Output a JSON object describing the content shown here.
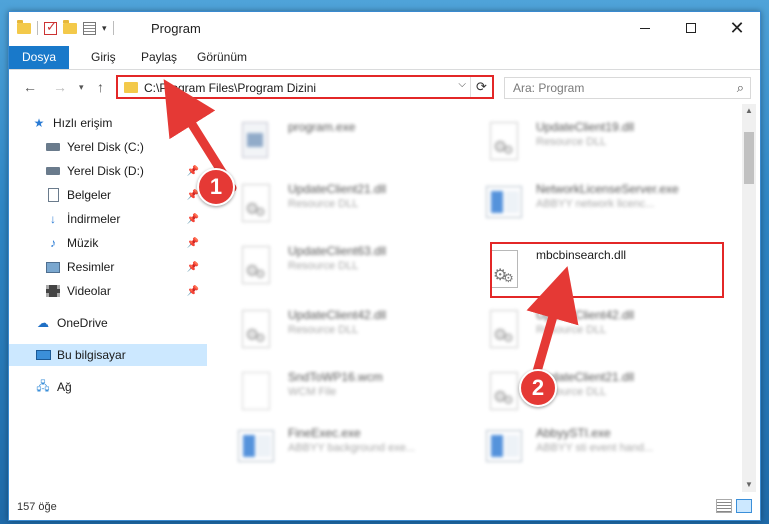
{
  "window": {
    "title": "Program",
    "controls": {
      "minimize": "minimize",
      "maximize": "maximize",
      "close": "✕"
    }
  },
  "ribbon": {
    "tabs": [
      {
        "label": "Dosya",
        "active": true
      },
      {
        "label": "Giriş"
      },
      {
        "label": "Paylaş"
      },
      {
        "label": "Görünüm"
      }
    ]
  },
  "address": {
    "path": "C:\\Program Files\\Program Dizini",
    "refresh_icon": "⟳"
  },
  "search": {
    "placeholder": "Ara: Program"
  },
  "navpane": {
    "items": [
      {
        "label": "Hızlı erişim",
        "icon": "star-icon",
        "pinned": false
      },
      {
        "label": "Yerel Disk (C:)",
        "icon": "drive-icon",
        "pinned": true
      },
      {
        "label": "Yerel Disk (D:)",
        "icon": "drive-icon",
        "pinned": true
      },
      {
        "label": "Belgeler",
        "icon": "documents-icon",
        "pinned": true
      },
      {
        "label": "İndirmeler",
        "icon": "download-icon",
        "pinned": true
      },
      {
        "label": "Müzik",
        "icon": "music-icon",
        "pinned": true
      },
      {
        "label": "Resimler",
        "icon": "pictures-icon",
        "pinned": true
      },
      {
        "label": "Videolar",
        "icon": "videos-icon",
        "pinned": true
      },
      {
        "label": "OneDrive",
        "icon": "cloud-icon",
        "pinned": false
      },
      {
        "label": "Bu bilgisayar",
        "icon": "computer-icon",
        "pinned": false,
        "selected": true
      },
      {
        "label": "Ağ",
        "icon": "network-icon",
        "pinned": false
      }
    ]
  },
  "files": {
    "left": [
      {
        "name": "program.exe",
        "desc": "",
        "icon": "exe-icon"
      },
      {
        "name": "UpdateClient21.dll",
        "desc": "Resource DLL",
        "icon": "dll-icon"
      },
      {
        "name": "UpdateClient63.dll",
        "desc": "Resource DLL",
        "icon": "dll-icon"
      },
      {
        "name": "UpdateClient42.dll",
        "desc": "Resource DLL",
        "icon": "dll-icon"
      },
      {
        "name": "SndToWP16.wcm",
        "desc": "WCM File",
        "icon": "file-icon"
      },
      {
        "name": "FineExec.exe",
        "desc": "ABBYY background exe...",
        "icon": "app-icon"
      }
    ],
    "right": [
      {
        "name": "UpdateClient19.dll",
        "desc": "Resource DLL",
        "icon": "dll-icon"
      },
      {
        "name": "NetworkLicenseServer.exe",
        "desc": "ABBYY network licenc...",
        "icon": "app-icon"
      },
      {
        "name": "mbcbinsearch.dll",
        "desc": "",
        "icon": "dll-icon",
        "highlighted": true
      },
      {
        "name": "UpdateClient42.dll",
        "desc": "Resource DLL",
        "icon": "dll-icon"
      },
      {
        "name": "UpdateClient21.dll",
        "desc": "Resource DLL",
        "icon": "dll-icon"
      },
      {
        "name": "AbbyySTI.exe",
        "desc": "ABBYY sti event hand...",
        "icon": "app-icon"
      }
    ]
  },
  "status": {
    "count": "157 öğe"
  },
  "annotations": {
    "badge1": "1",
    "badge2": "2",
    "color": "#e53935"
  }
}
